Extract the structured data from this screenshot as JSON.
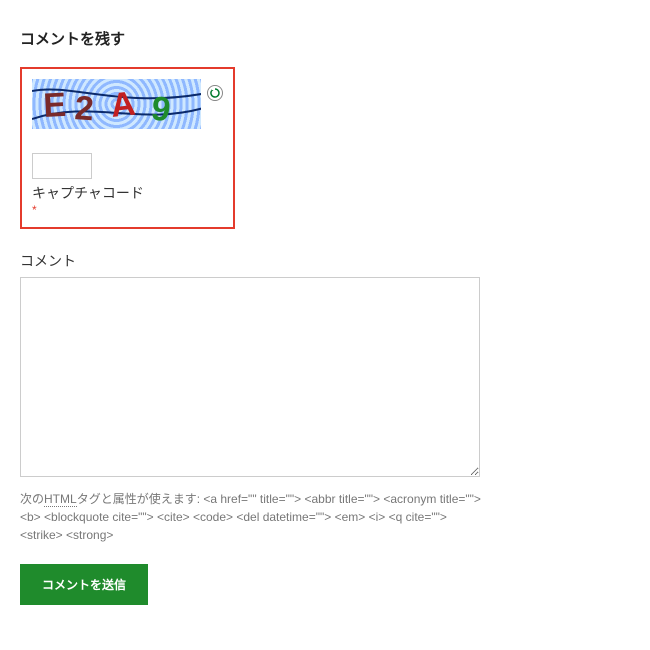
{
  "heading": "コメントを残す",
  "captcha": {
    "text": "E2A9",
    "label": "キャプチャコード",
    "required_marker": "*",
    "input_value": "",
    "refresh_icon_name": "refresh-icon"
  },
  "comment": {
    "label": "コメント",
    "value": ""
  },
  "allowed_tags": {
    "prefix": "次の",
    "html_abbr": "HTML",
    "suffix": "タグと属性が使えます: ",
    "tags": "<a href=\"\" title=\"\"> <abbr title=\"\"> <acronym title=\"\"> <b> <blockquote cite=\"\"> <cite> <code> <del datetime=\"\"> <em> <i> <q cite=\"\"> <strike> <strong>"
  },
  "submit_label": "コメントを送信"
}
